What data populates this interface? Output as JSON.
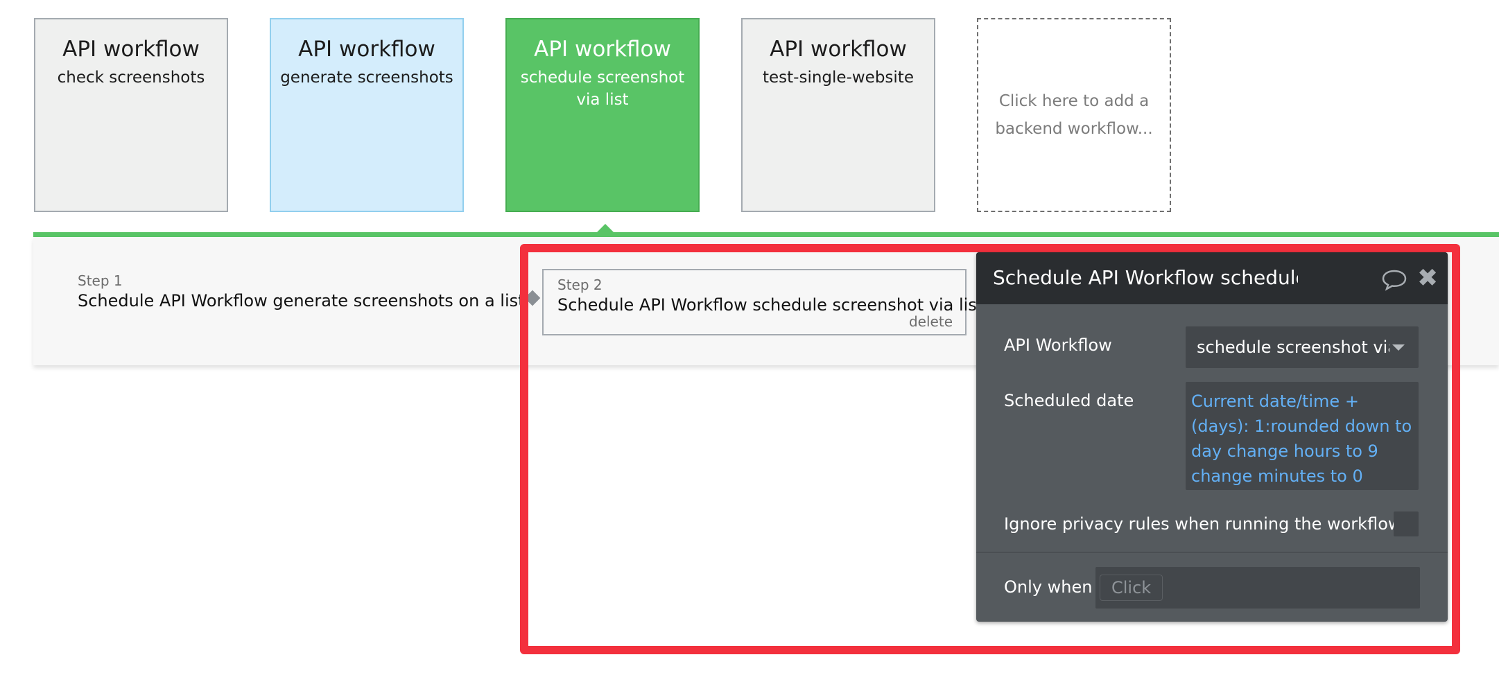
{
  "workflows": [
    {
      "type": "API workflow",
      "name": "check screenshots",
      "style": "gray"
    },
    {
      "type": "API workflow",
      "name": "generate screenshots",
      "style": "blue"
    },
    {
      "type": "API workflow",
      "name": "schedule screenshot via list",
      "style": "green"
    },
    {
      "type": "API workflow",
      "name": "test-single-website",
      "style": "gray"
    }
  ],
  "add_workflow_label": "Click here to add a backend workflow...",
  "steps": [
    {
      "number": "Step 1",
      "title": "Schedule API Workflow generate screenshots on a list"
    },
    {
      "number": "Step 2",
      "title": "Schedule API Workflow schedule screenshot via list",
      "delete_label": "delete"
    }
  ],
  "panel": {
    "title": "Schedule API Workflow schedule screenshot via list",
    "api_workflow_label": "API Workflow",
    "api_workflow_value": "schedule screenshot via list",
    "scheduled_date_label": "Scheduled date",
    "scheduled_date_expression": "Current date/time +(days): 1:rounded down to day change hours to 9 change minutes to 0",
    "ignore_privacy_label": "Ignore privacy rules when running the workflow",
    "only_when_label": "Only when",
    "only_when_placeholder": "Click"
  },
  "colors": {
    "accent_green": "#59c466",
    "highlight_red": "#f3303d",
    "expression_blue": "#63b0f5",
    "panel_bg": "#555a5e"
  }
}
